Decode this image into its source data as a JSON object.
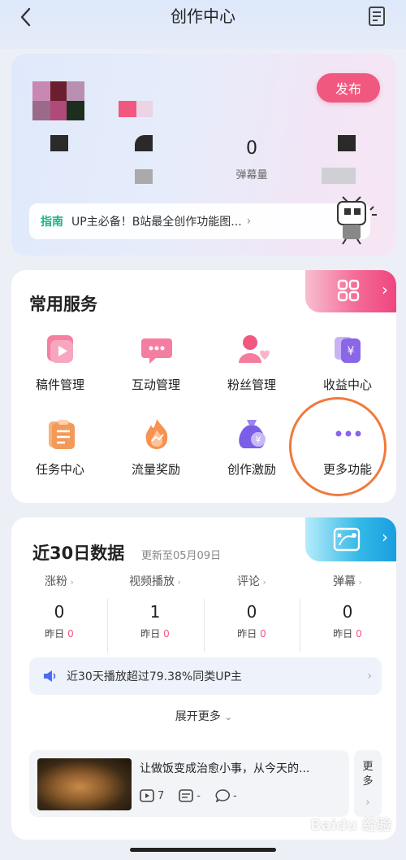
{
  "header": {
    "title": "创作中心"
  },
  "profile": {
    "publish_label": "发布",
    "stats": [
      {
        "value": "0",
        "label": "弹幕量"
      }
    ],
    "guide": {
      "tag": "指南",
      "text": "UP主必备！B站最全创作功能图...",
      "chevron": "›"
    }
  },
  "services": {
    "title": "常用服务",
    "items": [
      {
        "label": "稿件管理",
        "icon": "manuscript-icon"
      },
      {
        "label": "互动管理",
        "icon": "chat-bubble-icon"
      },
      {
        "label": "粉丝管理",
        "icon": "fans-icon"
      },
      {
        "label": "收益中心",
        "icon": "yen-card-icon"
      },
      {
        "label": "任务中心",
        "icon": "task-clipboard-icon"
      },
      {
        "label": "流量奖励",
        "icon": "flame-icon"
      },
      {
        "label": "创作激励",
        "icon": "money-bag-icon"
      },
      {
        "label": "更多功能",
        "icon": "more-dots-icon"
      }
    ]
  },
  "data": {
    "title": "近30日数据",
    "update": "更新至05月09日",
    "metrics": [
      {
        "label": "涨粉",
        "value": "0",
        "yest_label": "昨日",
        "yest_value": "0"
      },
      {
        "label": "视频播放",
        "value": "1",
        "yest_label": "昨日",
        "yest_value": "0"
      },
      {
        "label": "评论",
        "value": "0",
        "yest_label": "昨日",
        "yest_value": "0"
      },
      {
        "label": "弹幕",
        "value": "0",
        "yest_label": "昨日",
        "yest_value": "0"
      }
    ],
    "insight": "近30天播放超过79.38%同类UP主",
    "expand": "展开更多",
    "video": {
      "title": "让做饭变成治愈小事，从今天的...",
      "plays": "7",
      "danmaku": "-",
      "comments": "-"
    },
    "more_side": "更多"
  },
  "watermark": "Baidu 经验",
  "colors": {
    "accent_pink": "#f0587f",
    "accent_blue": "#1a9ee0",
    "guide_green": "#1cb28a",
    "annotation_orange": "#f07a3c"
  }
}
